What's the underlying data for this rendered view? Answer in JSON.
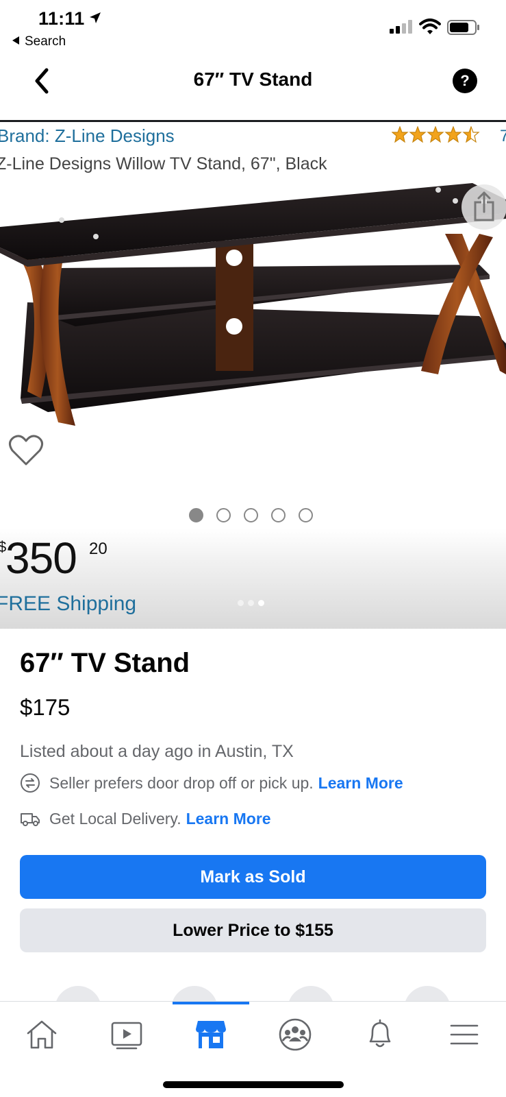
{
  "status_bar": {
    "time": "11:11",
    "back_label": "Search",
    "icons": [
      "location-arrow-icon",
      "cellular-signal-icon",
      "wifi-icon",
      "battery-icon"
    ]
  },
  "nav": {
    "title": "67″ TV Stand",
    "back_icon": "chevron-left-icon",
    "help_label": "?"
  },
  "photo": {
    "brand": "Brand: Z-Line Designs",
    "rating_stars": 4.5,
    "rating_count_fragment": "7",
    "subtitle": "Z-Line Designs Willow TV Stand, 67\", Black",
    "price_symbol": "$",
    "price_whole": "350",
    "price_cents": "20",
    "shipping": "FREE Shipping",
    "image_dots_total": 5,
    "image_dots_active": 1,
    "pager_total": 3,
    "pager_active": 3
  },
  "listing": {
    "title": "67″ TV Stand",
    "price": "$175",
    "listed": "Listed about a day ago in Austin, TX",
    "pickup_text": "Seller prefers door drop off or pick up.",
    "pickup_link": "Learn More",
    "delivery_text": "Get Local Delivery.",
    "delivery_link": "Learn More"
  },
  "actions": {
    "primary": "Mark as Sold",
    "secondary": "Lower Price to $155"
  },
  "tab_bar": {
    "tabs": [
      {
        "name": "home",
        "icon": "home-icon",
        "active": false
      },
      {
        "name": "watch",
        "icon": "video-play-icon",
        "active": false
      },
      {
        "name": "marketplace",
        "icon": "marketplace-shop-icon",
        "active": true
      },
      {
        "name": "groups",
        "icon": "groups-icon",
        "active": false
      },
      {
        "name": "notifications",
        "icon": "bell-icon",
        "active": false
      },
      {
        "name": "menu",
        "icon": "hamburger-menu-icon",
        "active": false
      }
    ]
  },
  "colors": {
    "accent": "#1877f2",
    "secondary_button": "#e4e6eb",
    "muted_text": "#65676b",
    "amazon_link": "#1f6f9c"
  }
}
